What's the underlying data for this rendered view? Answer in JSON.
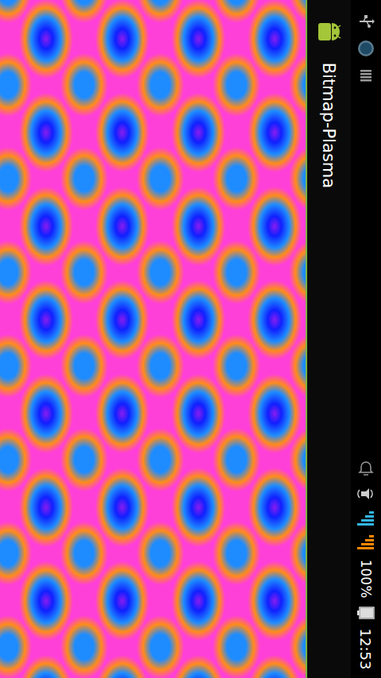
{
  "app": {
    "title": "Bitmap-Plasma"
  },
  "status_bar": {
    "battery": "100%",
    "battery_level": 1,
    "time": "12:53",
    "signals": [
      {
        "level": 1,
        "color": "#33b5e5"
      },
      {
        "level": 1,
        "color": "#ff8800"
      }
    ]
  }
}
